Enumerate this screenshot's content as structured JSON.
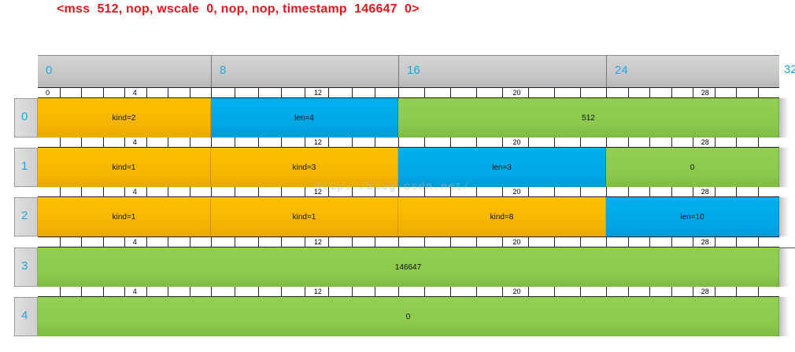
{
  "title": "<mss  512, nop, wscale  0, nop, nop, timestamp  146647  0>",
  "header": {
    "bits": [
      "0",
      "8",
      "16",
      "24",
      "32"
    ]
  },
  "ruler": {
    "first": [
      "0",
      "4",
      "12",
      "20",
      "28"
    ],
    "rest": [
      "4",
      "12",
      "20",
      "28"
    ]
  },
  "rows": [
    {
      "label": "0",
      "fields": [
        {
          "text": "kind=2",
          "color": "#ffc000",
          "bits": 8
        },
        {
          "text": "len=4",
          "color": "#00b0f0",
          "bits": 8
        },
        {
          "text": "512",
          "color": "#92d050",
          "bits": 16
        }
      ]
    },
    {
      "label": "1",
      "fields": [
        {
          "text": "kind=1",
          "color": "#ffc000",
          "bits": 8
        },
        {
          "text": "kind=3",
          "color": "#ffc000",
          "bits": 8
        },
        {
          "text": "len=3",
          "color": "#00b0f0",
          "bits": 8
        },
        {
          "text": "0",
          "color": "#92d050",
          "bits": 8
        }
      ]
    },
    {
      "label": "2",
      "fields": [
        {
          "text": "kind=1",
          "color": "#ffc000",
          "bits": 8
        },
        {
          "text": "kind=1",
          "color": "#ffc000",
          "bits": 8
        },
        {
          "text": "kind=8",
          "color": "#ffc000",
          "bits": 8
        },
        {
          "text": "len=10",
          "color": "#00b0f0",
          "bits": 8
        }
      ]
    },
    {
      "label": "3",
      "fields": [
        {
          "text": "146647",
          "color": "#92d050",
          "bits": 32
        }
      ]
    },
    {
      "label": "4",
      "fields": [
        {
          "text": "0",
          "color": "#92d050",
          "bits": 32
        }
      ]
    }
  ],
  "watermark": "http://blog.csdn.net/"
}
